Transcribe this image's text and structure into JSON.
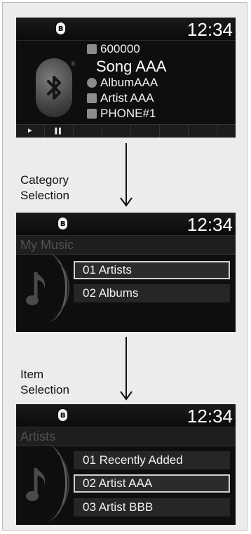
{
  "screens": {
    "now_playing": {
      "clock": "12:34",
      "status_icon": "bluetooth-icon",
      "track_number": "600000",
      "song": "Song AAA",
      "album": "AlbumAAA",
      "artist": "Artist AAA",
      "device": "PHONE#1",
      "play_label": "►",
      "pause_label": "▌▌"
    },
    "category": {
      "clock": "12:34",
      "header": "My Music",
      "items": [
        "01 Artists",
        "02 Albums"
      ],
      "selected_index": 0
    },
    "item": {
      "clock": "12:34",
      "header": "Artists",
      "items": [
        "01 Recently Added",
        "02 Artist AAA",
        "03 Artist BBB"
      ],
      "selected_index": 1
    }
  },
  "captions": {
    "category_selection_line1": "Category",
    "category_selection_line2": "Selection",
    "item_selection_line1": "Item",
    "item_selection_line2": "Selection"
  },
  "colors": {
    "screen_bg": "#0e0e0e",
    "item_bg": "#262626",
    "highlight_border": "#d0d0d0",
    "panel_bg": "#ececec"
  }
}
